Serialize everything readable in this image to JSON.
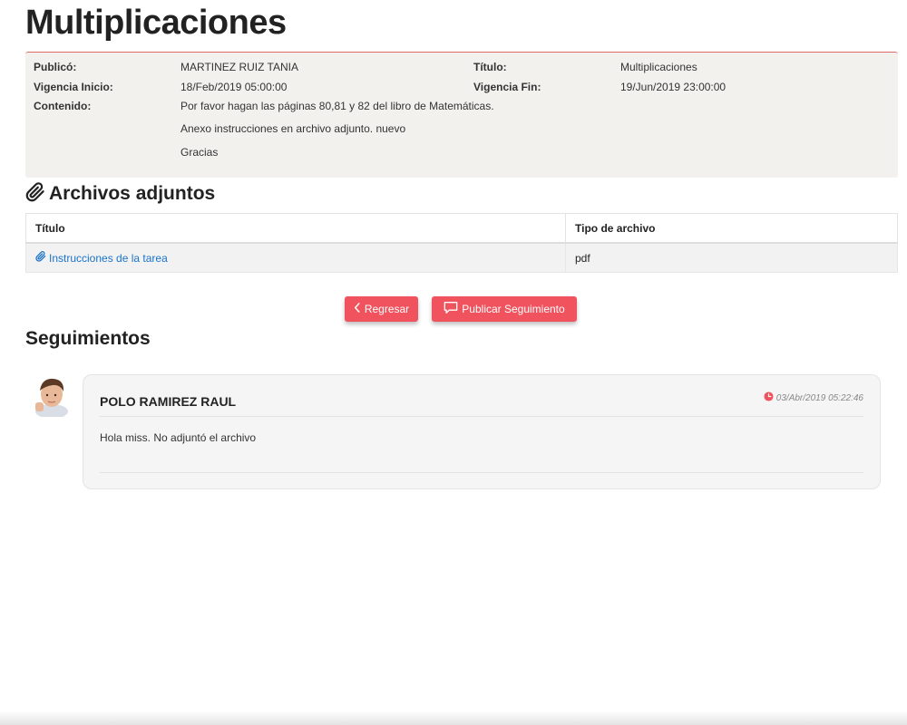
{
  "page": {
    "title": "Multiplicaciones"
  },
  "details": {
    "published_label": "Publicó:",
    "published_value": "MARTINEZ RUIZ TANIA",
    "title_label": "Título:",
    "title_value": "Multiplicaciones",
    "start_label": "Vigencia Inicio:",
    "start_value": "18/Feb/2019 05:00:00",
    "end_label": "Vigencia Fin:",
    "end_value": "19/Jun/2019 23:00:00",
    "content_label": "Contenido:",
    "content_lines": [
      "Por favor hagan las páginas 80,81 y 82 del libro de Matemáticas.",
      "Anexo instrucciones en archivo adjunto. nuevo",
      "Gracias"
    ]
  },
  "attachments": {
    "heading": "Archivos adjuntos",
    "columns": [
      "Título",
      "Tipo de archivo"
    ],
    "rows": [
      {
        "title": "Instrucciones de la tarea",
        "type": "pdf"
      }
    ]
  },
  "actions": {
    "back_label": "Regresar",
    "publish_label": "Publicar Seguimiento"
  },
  "followups": {
    "heading": "Seguimientos",
    "items": [
      {
        "author": "POLO RAMIREZ RAUL",
        "timestamp": "03/Abr/2019 05:22:46",
        "text": "Hola miss. No adjuntó el archivo"
      }
    ]
  },
  "colors": {
    "accent": "#f0525e",
    "link": "#1a73c9",
    "panel_bg": "#f2f1ee"
  },
  "icons": [
    "paperclip-icon",
    "chevron-left-icon",
    "comment-icon",
    "clock-icon"
  ]
}
